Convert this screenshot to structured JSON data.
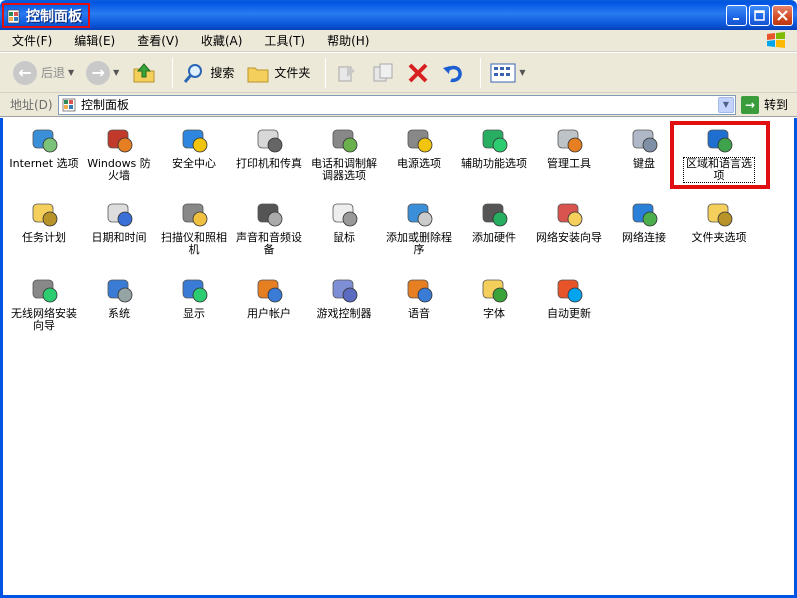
{
  "window": {
    "title": "控制面板"
  },
  "menubar": [
    {
      "label": "文件(F)"
    },
    {
      "label": "编辑(E)"
    },
    {
      "label": "查看(V)"
    },
    {
      "label": "收藏(A)"
    },
    {
      "label": "工具(T)"
    },
    {
      "label": "帮助(H)"
    }
  ],
  "toolbar": {
    "back_label": "后退",
    "search_label": "搜索",
    "folders_label": "文件夹"
  },
  "address": {
    "label": "地址(D)",
    "value": "控制面板",
    "go_label": "转到"
  },
  "items": [
    {
      "label": "Internet 选项",
      "icon": "internet-options-icon"
    },
    {
      "label": "Windows 防火墙",
      "icon": "firewall-icon"
    },
    {
      "label": "安全中心",
      "icon": "security-center-icon"
    },
    {
      "label": "打印机和传真",
      "icon": "printer-icon"
    },
    {
      "label": "电话和调制解调器选项",
      "icon": "phone-modem-icon"
    },
    {
      "label": "电源选项",
      "icon": "power-options-icon"
    },
    {
      "label": "辅助功能选项",
      "icon": "accessibility-icon"
    },
    {
      "label": "管理工具",
      "icon": "admin-tools-icon"
    },
    {
      "label": "键盘",
      "icon": "keyboard-icon"
    },
    {
      "label": "区域和语言选项",
      "icon": "globe-icon"
    },
    {
      "label": "任务计划",
      "icon": "scheduled-tasks-icon"
    },
    {
      "label": "日期和时间",
      "icon": "date-time-icon"
    },
    {
      "label": "扫描仪和照相机",
      "icon": "scanner-camera-icon"
    },
    {
      "label": "声音和音频设备",
      "icon": "speaker-icon"
    },
    {
      "label": "鼠标",
      "icon": "mouse-icon"
    },
    {
      "label": "添加或删除程序",
      "icon": "add-remove-programs-icon"
    },
    {
      "label": "添加硬件",
      "icon": "add-hardware-icon"
    },
    {
      "label": "网络安装向导",
      "icon": "network-setup-icon"
    },
    {
      "label": "网络连接",
      "icon": "network-connections-icon"
    },
    {
      "label": "文件夹选项",
      "icon": "folder-options-icon"
    },
    {
      "label": "无线网络安装向导",
      "icon": "wireless-icon"
    },
    {
      "label": "系统",
      "icon": "system-icon"
    },
    {
      "label": "显示",
      "icon": "display-icon"
    },
    {
      "label": "用户帐户",
      "icon": "user-accounts-icon"
    },
    {
      "label": "游戏控制器",
      "icon": "game-controller-icon"
    },
    {
      "label": "语音",
      "icon": "speech-icon"
    },
    {
      "label": "字体",
      "icon": "fonts-icon"
    },
    {
      "label": "自动更新",
      "icon": "windows-update-icon"
    }
  ],
  "colors": {
    "title_blue": "#0054e3",
    "highlight_red": "#e01010",
    "chrome": "#ece9d8"
  }
}
